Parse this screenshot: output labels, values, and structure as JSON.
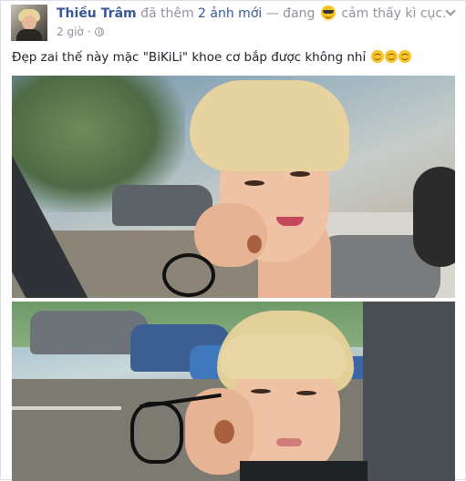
{
  "post": {
    "author": "Thiều Trâm",
    "action_prefix": "đã thêm",
    "action_link": "2 ảnh mới",
    "feeling_prefix": "— đang",
    "feeling_emoji": "cool-face-icon",
    "feeling_text": "cảm thấy kì cục.",
    "timestamp": "2 giờ",
    "separator": "·",
    "privacy_icon": "globe-icon",
    "caption": "Đẹp zai thế này mặc \"BiKiLi\" khoe cơ bắp được không nhỉ",
    "caption_emoji": [
      "smile-icon",
      "smile-icon",
      "smile-icon"
    ],
    "photos": [
      {
        "subject": "woman with short blonde hair smiling, holding glasses, henna on hand, street background"
      },
      {
        "subject": "woman with short blonde hair, hand near eye, holding glasses, parked cars background"
      }
    ]
  },
  "colors": {
    "link": "#365899",
    "meta": "#90949c",
    "text": "#1d2129",
    "border": "#dddfe2"
  }
}
